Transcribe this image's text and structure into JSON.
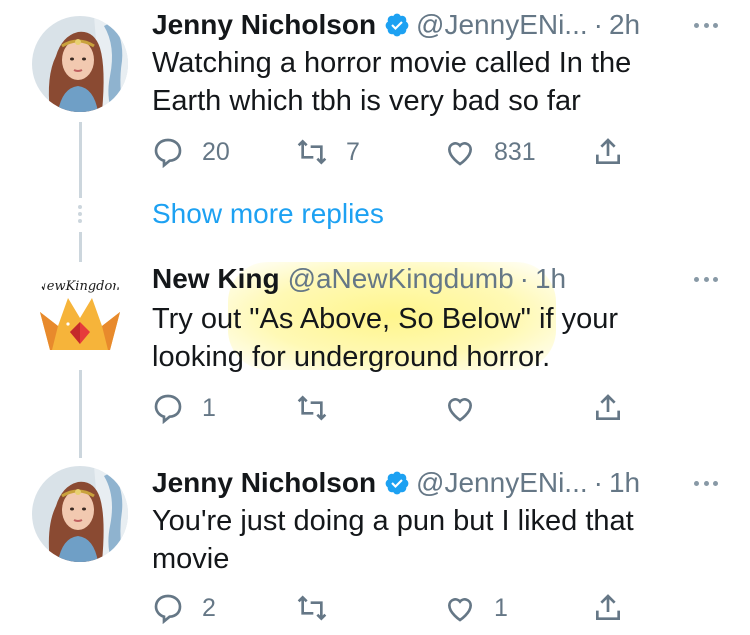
{
  "tweets": [
    {
      "name": "Jenny Nicholson",
      "handle": "@JennyENi...",
      "time": "2h",
      "text_lines": [
        "Watching a horror movie called In the",
        "Earth which tbh is very bad so far"
      ],
      "replies": "20",
      "retweets": "7",
      "likes": "831"
    },
    {
      "name": "New King",
      "handle": "@aNewKingdumb",
      "time": "1h",
      "avatar_label": "NewKingdom",
      "text_lines": [
        "Try out \"As Above, So Below\" if your",
        "looking for underground horror."
      ],
      "replies": "1",
      "retweets": "",
      "likes": ""
    },
    {
      "name": "Jenny Nicholson",
      "handle": "@JennyENi...",
      "time": "1h",
      "text_lines": [
        "You're just doing a pun but I liked that",
        "movie"
      ],
      "replies": "2",
      "retweets": "",
      "likes": "1"
    }
  ],
  "show_more": "Show more replies",
  "separator": "·",
  "colors": {
    "accent": "#1da1f2",
    "secondary_text": "#657786",
    "thread_line": "#ccd6dd",
    "highlight": "#fff478"
  },
  "icons": {
    "reply": "reply-icon",
    "retweet": "retweet-icon",
    "like": "heart-icon",
    "share": "share-icon",
    "verified": "verified-badge-icon",
    "more": "more-icon"
  }
}
